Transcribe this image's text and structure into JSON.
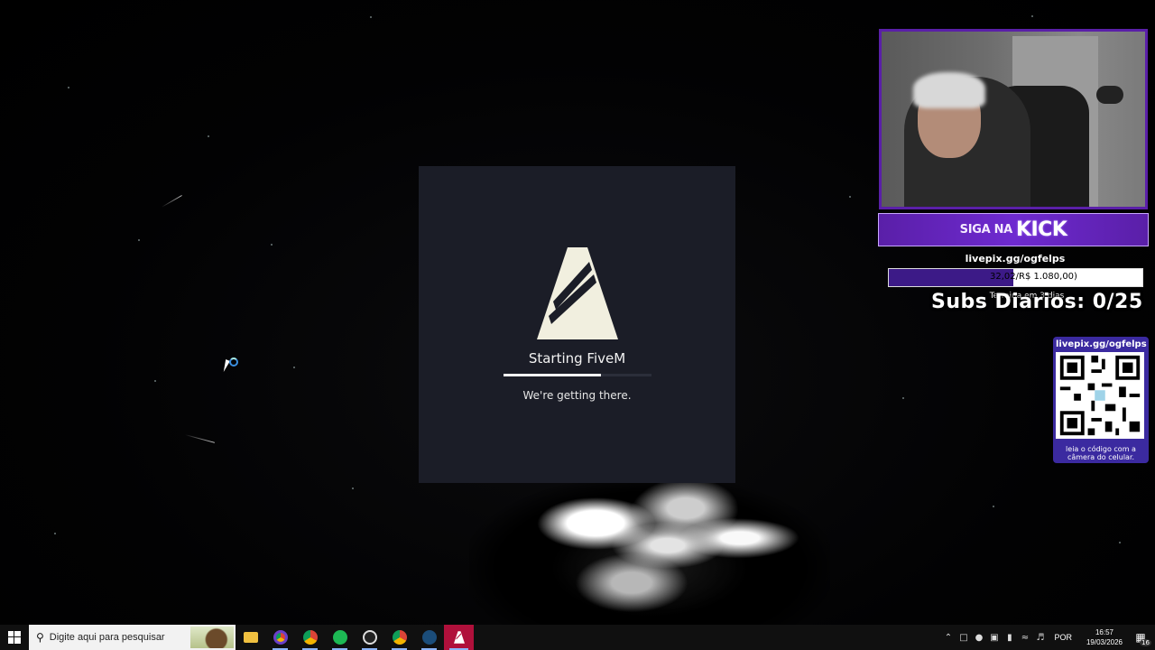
{
  "splash": {
    "title": "Starting FiveM",
    "subtitle": "We're getting there.",
    "progress_fraction": 0.66
  },
  "overlay": {
    "kick_prefix": "SIGA NA",
    "kick_word": "KICK",
    "goal_url": "livepix.gg/ogfelps",
    "goal_amount": "32,02/R$ 1.080,00)",
    "goal_progress_fraction": 0.49,
    "goal_ends": "Termina em 3 dias",
    "subs_daily": "Subs Diarios: 0/25",
    "qr_url": "livepix.gg/ogfelps",
    "qr_caption": "leia o código com a câmera do celular."
  },
  "taskbar": {
    "search_placeholder": "Digite aqui para pesquisar",
    "language": "POR",
    "time": "16:57",
    "date": "19/03/2026",
    "notifications": "16",
    "icons": [
      "file-explorer-icon",
      "chrome-profile-icon",
      "chrome-icon",
      "spotify-icon",
      "obs-icon",
      "chrome-alt-icon",
      "steam-icon",
      "fivem-icon"
    ]
  },
  "colors": {
    "splash_bg": "#1b1d27",
    "kick_purple": "#5a1fa8",
    "taskbar_bg": "#101010",
    "fivem_red": "#b0103b"
  }
}
